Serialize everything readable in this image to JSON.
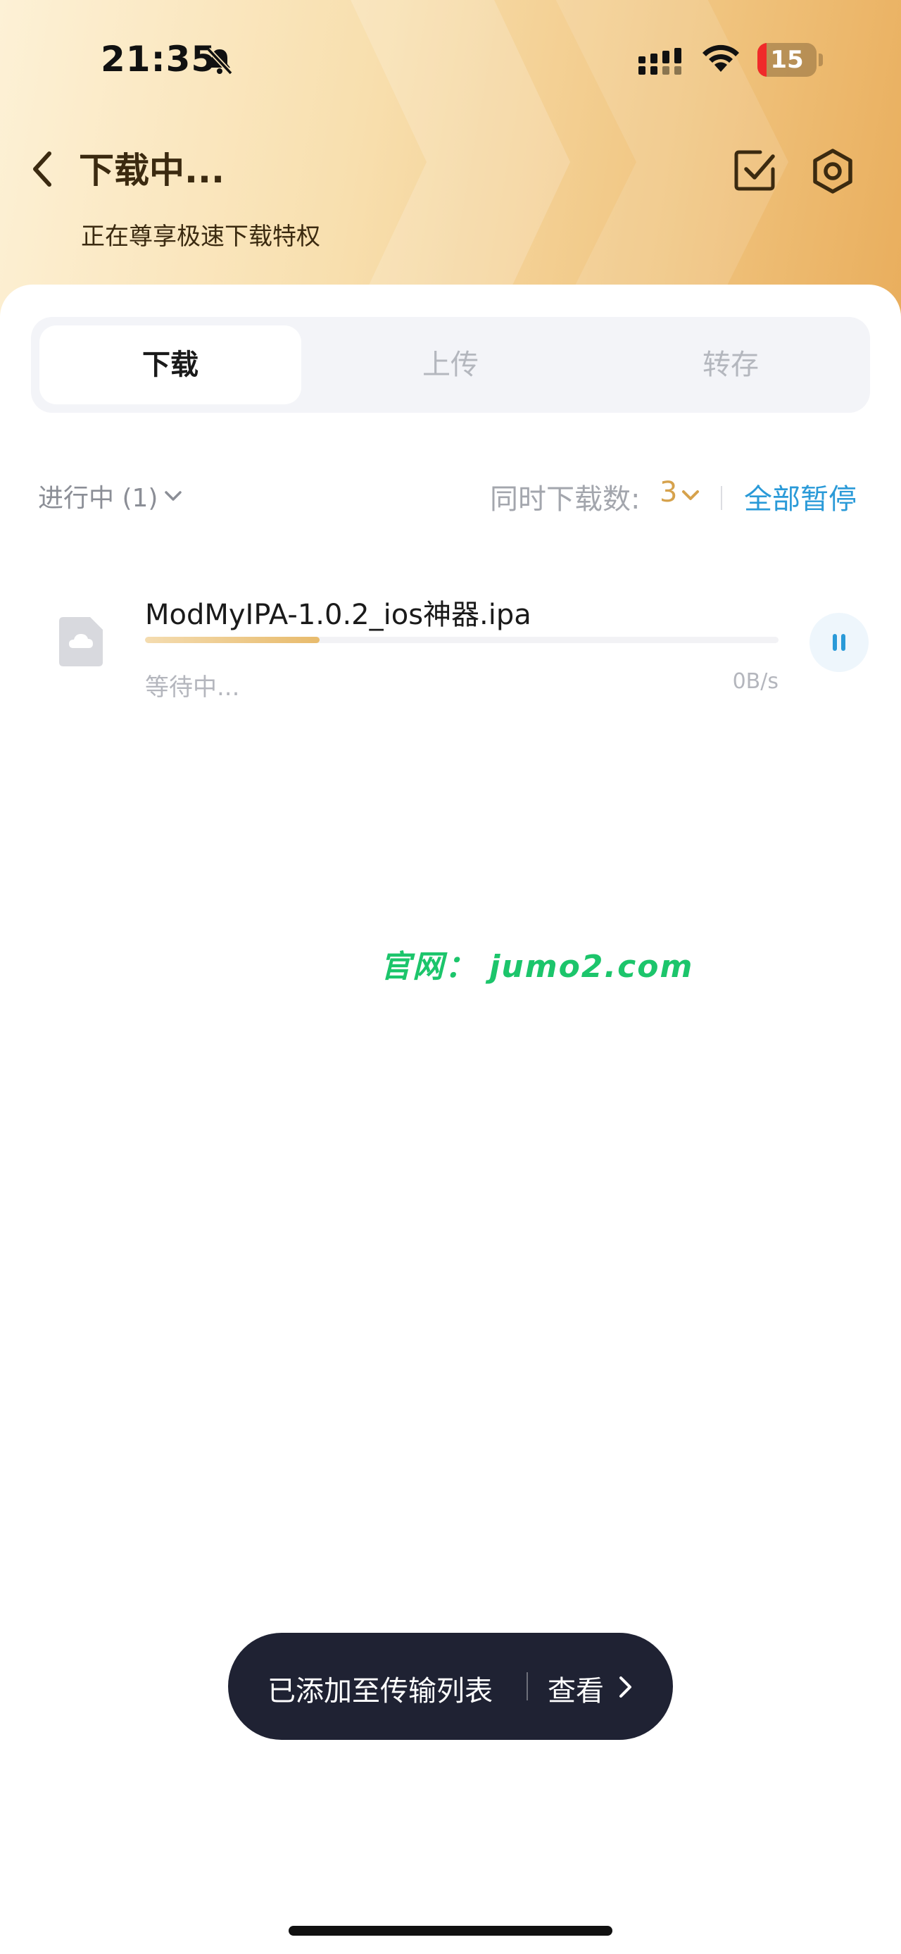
{
  "status_bar": {
    "time": "21:35",
    "battery_level": "15",
    "battery_color": "#f02a2a"
  },
  "header": {
    "title": "下载中...",
    "subtitle": "正在尊享极速下载特权"
  },
  "tabs": [
    {
      "label": "下载",
      "active": true
    },
    {
      "label": "上传",
      "active": false
    },
    {
      "label": "转存",
      "active": false
    }
  ],
  "list_controls": {
    "filter": "进行中 (1)",
    "concurrency_label": "同时下载数:",
    "concurrency_value": "3",
    "pause_all": "全部暂停"
  },
  "downloads": [
    {
      "file_name": "ModMyIPA-1.0.2_ios神器.ipa",
      "status": "等待中...",
      "speed": "0B/s",
      "progress": 0.275
    }
  ],
  "watermark": "官网： jumo2.com",
  "toast": {
    "message": "已添加至传输列表",
    "action": "查看"
  },
  "colors": {
    "accent_gold": "#d6a24c",
    "accent_blue": "#2a9ad8",
    "watermark_green": "#1cc56b"
  }
}
